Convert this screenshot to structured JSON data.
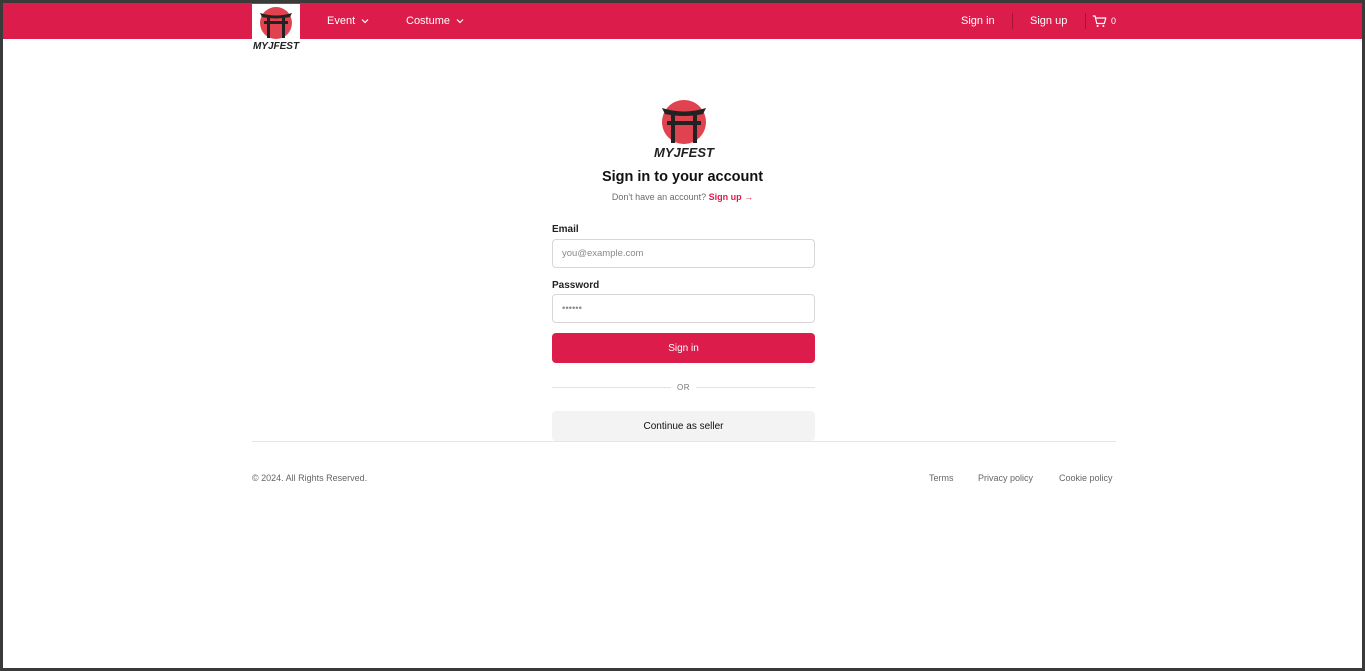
{
  "header": {
    "logo_text": "MYJFEST",
    "nav": [
      {
        "label": "Event"
      },
      {
        "label": "Costume"
      }
    ],
    "signin_label": "Sign in",
    "signup_label": "Sign up",
    "cart_count": "0",
    "icons": {
      "cart": "cart-icon",
      "chevron": "chevron-down-icon"
    }
  },
  "main": {
    "logo_text": "MYJFEST",
    "title": "Sign in to your account",
    "subtitle_text": "Don't have an account?",
    "subtitle_link": "Sign up →",
    "email_label": "Email",
    "email_placeholder": "you@example.com",
    "password_label": "Password",
    "password_placeholder": "••••••",
    "signin_button": "Sign in",
    "or_text": "OR",
    "seller_button": "Continue as seller"
  },
  "footer": {
    "copyright": "© 2024. All Rights Reserved.",
    "links": [
      "Terms",
      "Privacy policy",
      "Cookie policy"
    ]
  },
  "colors": {
    "brand": "#dc1c4b",
    "logo_circle": "#e0424f",
    "logo_dark": "#222222"
  }
}
